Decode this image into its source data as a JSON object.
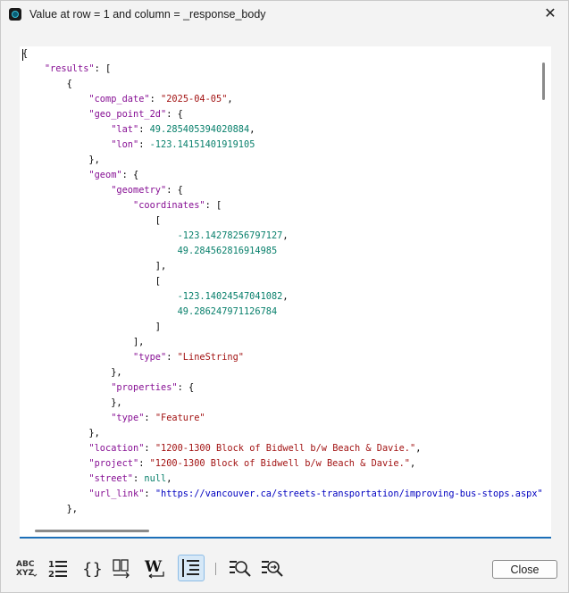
{
  "window": {
    "title": "Value at row = 1 and column = _response_body",
    "close_glyph": "✕"
  },
  "editor": {
    "lines": [
      [
        {
          "t": "{",
          "c": ""
        }
      ],
      [
        {
          "t": "    ",
          "c": ""
        },
        {
          "t": "\"results\"",
          "c": "k"
        },
        {
          "t": ": [",
          "c": ""
        }
      ],
      [
        {
          "t": "        {",
          "c": ""
        }
      ],
      [
        {
          "t": "            ",
          "c": ""
        },
        {
          "t": "\"comp_date\"",
          "c": "k"
        },
        {
          "t": ": ",
          "c": ""
        },
        {
          "t": "\"2025-04-05\"",
          "c": "s"
        },
        {
          "t": ",",
          "c": ""
        }
      ],
      [
        {
          "t": "            ",
          "c": ""
        },
        {
          "t": "\"geo_point_2d\"",
          "c": "k"
        },
        {
          "t": ": {",
          "c": ""
        }
      ],
      [
        {
          "t": "                ",
          "c": ""
        },
        {
          "t": "\"lat\"",
          "c": "k"
        },
        {
          "t": ": ",
          "c": ""
        },
        {
          "t": "49.285405394020884",
          "c": "n"
        },
        {
          "t": ",",
          "c": ""
        }
      ],
      [
        {
          "t": "                ",
          "c": ""
        },
        {
          "t": "\"lon\"",
          "c": "k"
        },
        {
          "t": ": ",
          "c": ""
        },
        {
          "t": "-123.14151401919105",
          "c": "n"
        }
      ],
      [
        {
          "t": "            },",
          "c": ""
        }
      ],
      [
        {
          "t": "            ",
          "c": ""
        },
        {
          "t": "\"geom\"",
          "c": "k"
        },
        {
          "t": ": {",
          "c": ""
        }
      ],
      [
        {
          "t": "                ",
          "c": ""
        },
        {
          "t": "\"geometry\"",
          "c": "k"
        },
        {
          "t": ": {",
          "c": ""
        }
      ],
      [
        {
          "t": "                    ",
          "c": ""
        },
        {
          "t": "\"coordinates\"",
          "c": "k"
        },
        {
          "t": ": [",
          "c": ""
        }
      ],
      [
        {
          "t": "                        [",
          "c": ""
        }
      ],
      [
        {
          "t": "                            ",
          "c": ""
        },
        {
          "t": "-123.14278256797127",
          "c": "n"
        },
        {
          "t": ",",
          "c": ""
        }
      ],
      [
        {
          "t": "                            ",
          "c": ""
        },
        {
          "t": "49.284562816914985",
          "c": "n"
        }
      ],
      [
        {
          "t": "                        ],",
          "c": ""
        }
      ],
      [
        {
          "t": "                        [",
          "c": ""
        }
      ],
      [
        {
          "t": "                            ",
          "c": ""
        },
        {
          "t": "-123.14024547041082",
          "c": "n"
        },
        {
          "t": ",",
          "c": ""
        }
      ],
      [
        {
          "t": "                            ",
          "c": ""
        },
        {
          "t": "49.286247971126784",
          "c": "n"
        }
      ],
      [
        {
          "t": "                        ]",
          "c": ""
        }
      ],
      [
        {
          "t": "                    ],",
          "c": ""
        }
      ],
      [
        {
          "t": "                    ",
          "c": ""
        },
        {
          "t": "\"type\"",
          "c": "k"
        },
        {
          "t": ": ",
          "c": ""
        },
        {
          "t": "\"LineString\"",
          "c": "s"
        }
      ],
      [
        {
          "t": "                },",
          "c": ""
        }
      ],
      [
        {
          "t": "                ",
          "c": ""
        },
        {
          "t": "\"properties\"",
          "c": "k"
        },
        {
          "t": ": {",
          "c": ""
        }
      ],
      [
        {
          "t": "                },",
          "c": ""
        }
      ],
      [
        {
          "t": "                ",
          "c": ""
        },
        {
          "t": "\"type\"",
          "c": "k"
        },
        {
          "t": ": ",
          "c": ""
        },
        {
          "t": "\"Feature\"",
          "c": "s"
        }
      ],
      [
        {
          "t": "            },",
          "c": ""
        }
      ],
      [
        {
          "t": "            ",
          "c": ""
        },
        {
          "t": "\"location\"",
          "c": "k"
        },
        {
          "t": ": ",
          "c": ""
        },
        {
          "t": "\"1200-1300 Block of Bidwell b/w Beach & Davie.\"",
          "c": "s"
        },
        {
          "t": ",",
          "c": ""
        }
      ],
      [
        {
          "t": "            ",
          "c": ""
        },
        {
          "t": "\"project\"",
          "c": "k"
        },
        {
          "t": ": ",
          "c": ""
        },
        {
          "t": "\"1200-1300 Block of Bidwell b/w Beach & Davie.\"",
          "c": "s"
        },
        {
          "t": ",",
          "c": ""
        }
      ],
      [
        {
          "t": "            ",
          "c": ""
        },
        {
          "t": "\"street\"",
          "c": "k"
        },
        {
          "t": ": ",
          "c": ""
        },
        {
          "t": "null",
          "c": "l"
        },
        {
          "t": ",",
          "c": ""
        }
      ],
      [
        {
          "t": "            ",
          "c": ""
        },
        {
          "t": "\"url_link\"",
          "c": "k"
        },
        {
          "t": ": ",
          "c": ""
        },
        {
          "t": "\"https://vancouver.ca/streets-transportation/improving-bus-stops.aspx\"",
          "c": "u"
        }
      ],
      [
        {
          "t": "        },",
          "c": ""
        }
      ]
    ]
  },
  "toolbar": {
    "buttons": [
      {
        "name": "spell-check-icon",
        "glyph": "ABC XYZ"
      },
      {
        "name": "line-numbers-icon",
        "glyph": "1≡ 2≡"
      },
      {
        "name": "braces-icon",
        "glyph": "{}"
      },
      {
        "name": "compare-icon",
        "glyph": "⎘"
      },
      {
        "name": "word-wrap-icon",
        "glyph": "W↩"
      },
      {
        "name": "format-icon",
        "glyph": "≣"
      },
      {
        "name": "find-icon",
        "glyph": "⌕"
      },
      {
        "name": "find-replace-icon",
        "glyph": "⌕"
      }
    ]
  },
  "footer": {
    "close_label": "Close"
  },
  "colors": {
    "key": "#871094",
    "string": "#a31515",
    "number": "#09806c",
    "url": "#0000c0",
    "accent": "#1c6fb8"
  }
}
